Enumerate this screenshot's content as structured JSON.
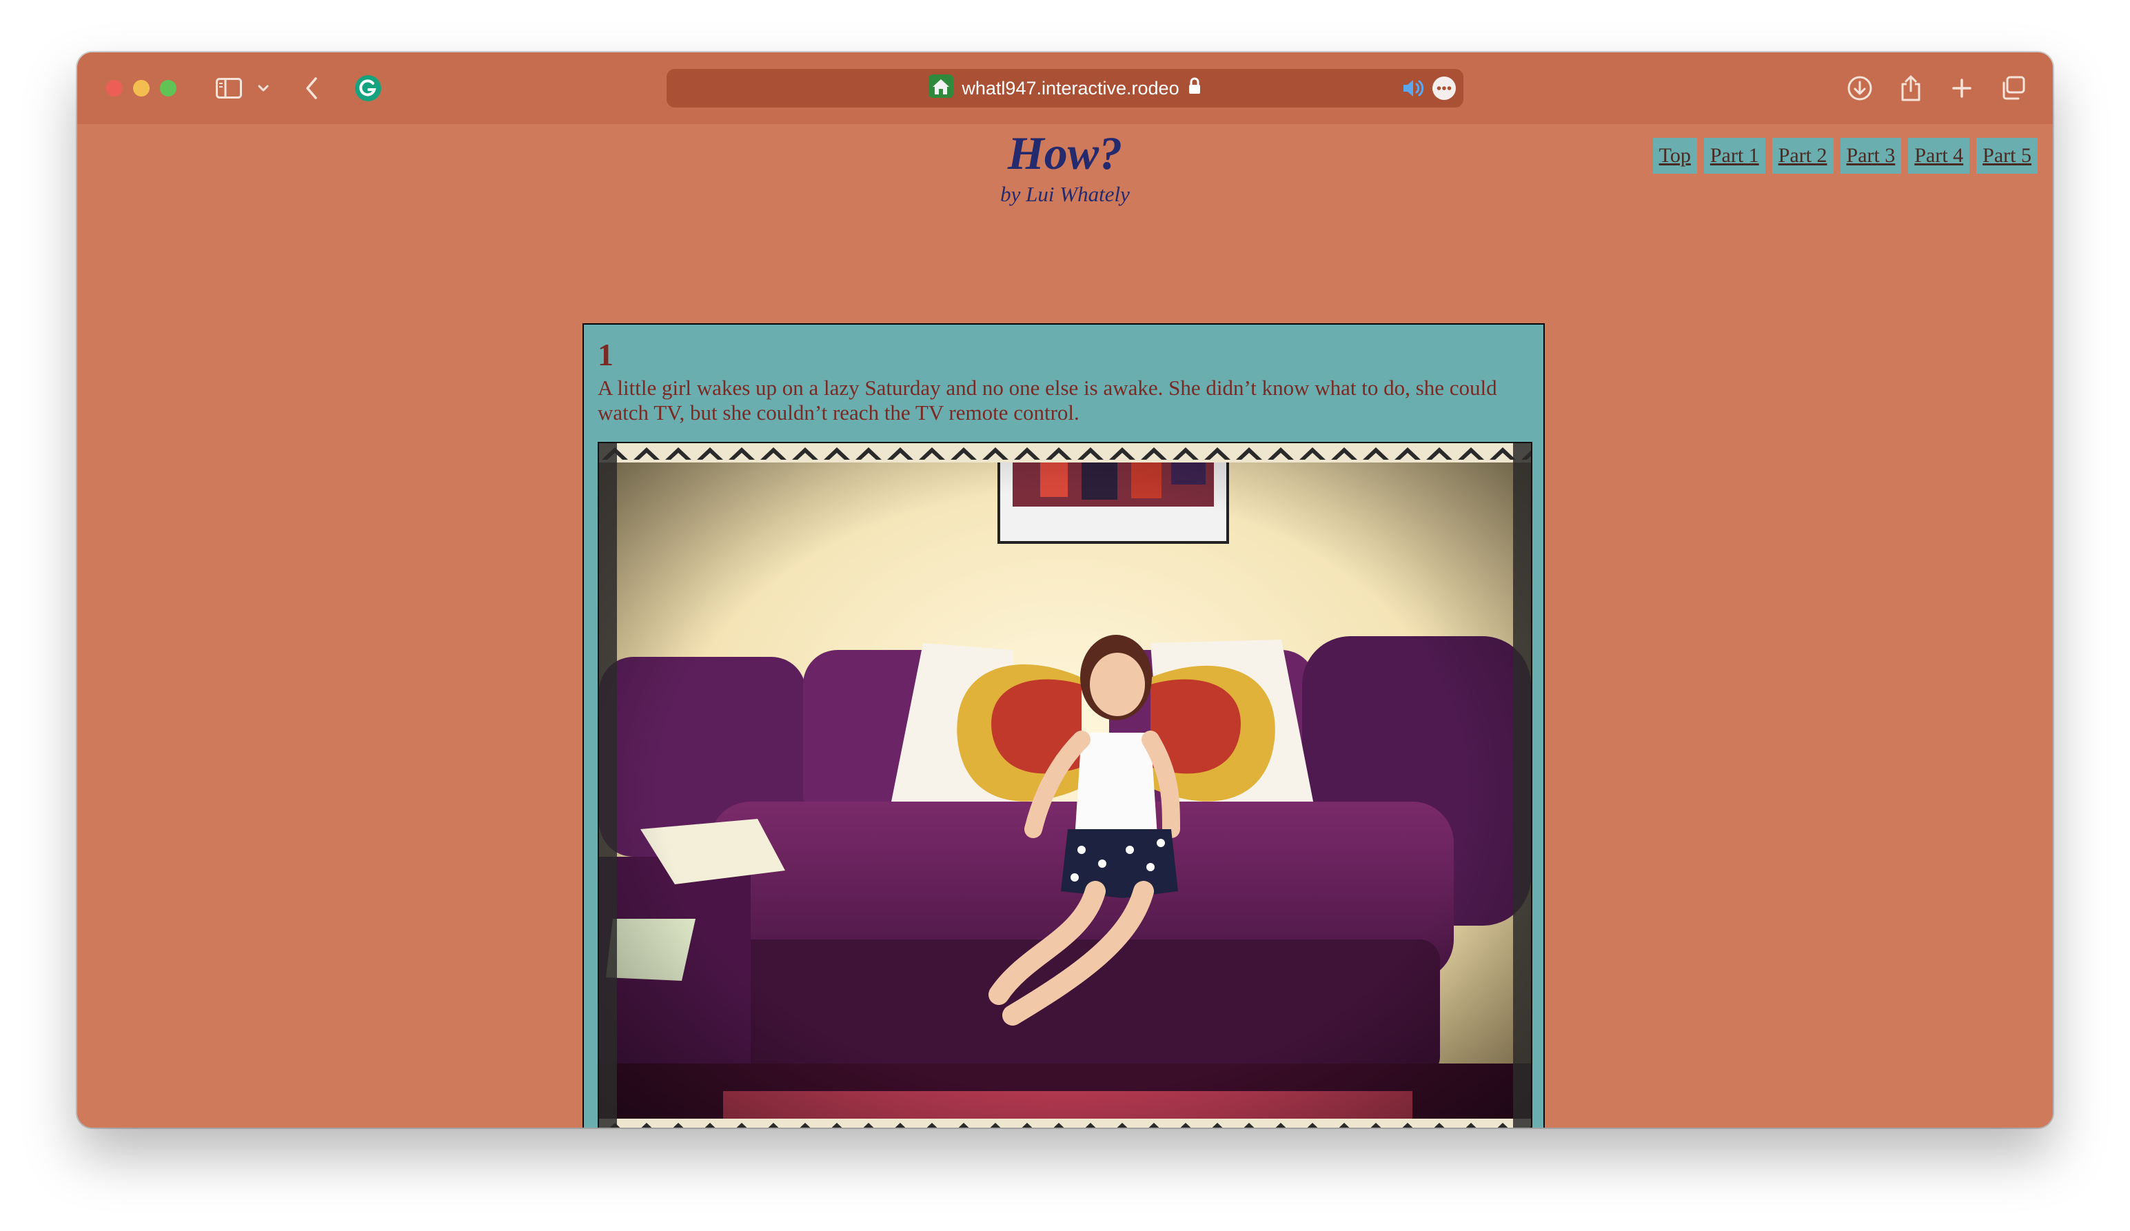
{
  "browser": {
    "url": "whatl947.interactive.rodeo",
    "icons": {
      "sidebar": "sidebar-icon",
      "chevron": "chevron-down-icon",
      "back": "back-arrow-icon",
      "extension": "grammarly-icon",
      "site": "home-icon",
      "lock": "lock-icon",
      "audio": "speaker-icon",
      "more": "more-icon",
      "download": "download-icon",
      "share": "share-icon",
      "new_tab": "plus-icon",
      "tabs": "tabs-overview-icon"
    }
  },
  "header": {
    "title": "How?",
    "byline": "by Lui Whately"
  },
  "nav": {
    "items": [
      {
        "label": "Top"
      },
      {
        "label": "Part 1"
      },
      {
        "label": "Part 2"
      },
      {
        "label": "Part 3"
      },
      {
        "label": "Part 4"
      },
      {
        "label": "Part 5"
      }
    ]
  },
  "section": {
    "number": "1",
    "text": "A little girl wakes up on a lazy Saturday and no one else is awake. She didn’t know what to do, she could watch TV, but she couldn’t reach the TV remote control."
  },
  "colors": {
    "page_bg": "#cf7a5b",
    "toolbar_bg": "#c76d4f",
    "panel_bg": "#6aaeb0",
    "title": "#232a6e",
    "body_text": "#7a2a23"
  }
}
